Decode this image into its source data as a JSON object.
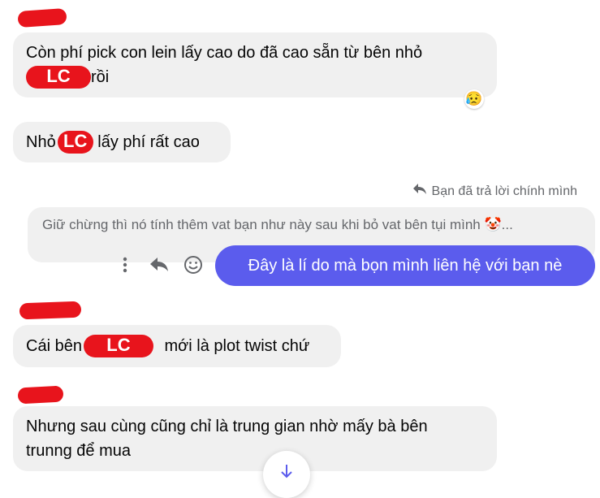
{
  "messages": [
    {
      "text_before": "Còn phí pick con lein lấy cao do đã cao sẵn từ bên nhỏ",
      "redacted": "LC",
      "text_after": " rồi",
      "reaction": "😥"
    },
    {
      "text_before": "Nhỏ",
      "redacted": "LC",
      "text_after": " lấy phí rất cao"
    }
  ],
  "reply": {
    "note": "Bạn đã trả lời chính mình",
    "quoted": "Giữ chừng thì nó tính thêm vat bạn như này sau khi bỏ vat bên tụi mình 🤡...",
    "text": "Đây là lí do mà bọn mình liên hệ với bạn nè"
  },
  "later": [
    {
      "text_before": "Cái bên",
      "redacted": "LC",
      "text_after": " mới là plot twist chứ"
    },
    {
      "line1": "Nhưng sau cùng cũng chỉ là trung gian nhờ mấy bà bên",
      "line2": "trunng để mua"
    }
  ],
  "icons": {
    "more": "more-vertical-icon",
    "reply": "reply-arrow-icon",
    "react": "smiley-icon",
    "scroll": "arrow-down-icon"
  },
  "colors": {
    "own_bubble": "#5b5ced",
    "redaction": "#e8141c",
    "bubble": "#f0f0f0"
  }
}
